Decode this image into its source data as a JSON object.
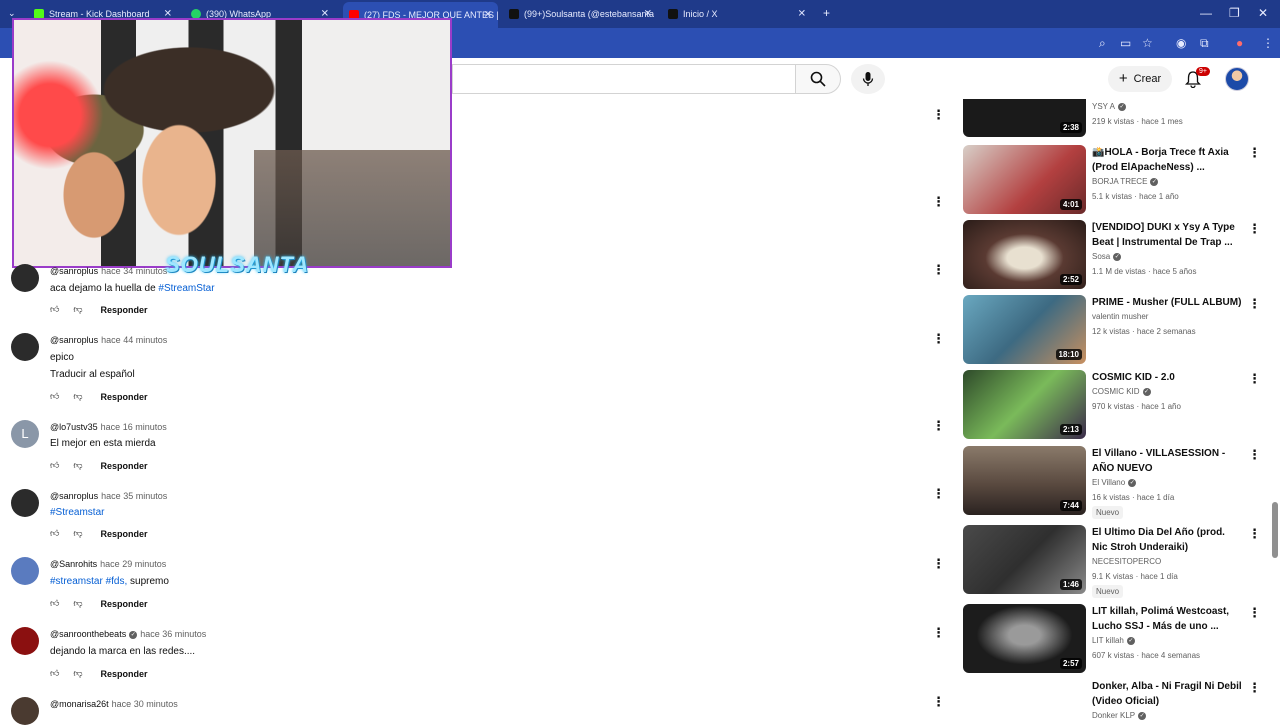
{
  "browser": {
    "tabs": [
      {
        "label": "Stream - Kick Dashboard",
        "color": "#53fc18"
      },
      {
        "label": "(390) WhatsApp",
        "color": "#25d366"
      },
      {
        "label": "(27) FDS - MEJOR QUE ANTES |",
        "color": "#ff0000"
      },
      {
        "label": "(99+)Soulsanta (@estebansanta",
        "color": "#000000"
      },
      {
        "label": "Inicio / X",
        "color": "#000000"
      }
    ],
    "new_tab": "+"
  },
  "header": {
    "create_label": "Crear",
    "notif_badge": "9+"
  },
  "overlay": {
    "logo_text": "SOULSANTA"
  },
  "comments": [
    {
      "handle": "@sanroplus",
      "time": "hace 34 minutos",
      "text": "aca dejamo la huella de ",
      "tags": "#StreamStar",
      "reply": "Responder",
      "avatar": "#2b2b2b"
    },
    {
      "handle": "@sanroplus",
      "time": "hace 44 minutos",
      "text": "epico",
      "extra": "Traducir al español",
      "reply": "Responder",
      "avatar": "#2b2b2b"
    },
    {
      "handle": "@lo7ustv35",
      "time": "hace 16 minutos",
      "text": "El mejor en esta mierda",
      "reply": "Responder",
      "avatar": "#8a97a8",
      "initial": "L"
    },
    {
      "handle": "@sanroplus",
      "time": "hace 35 minutos",
      "text": "",
      "tags": "#Streamstar",
      "reply": "Responder",
      "avatar": "#2b2b2b"
    },
    {
      "handle": "@Sanrohits",
      "time": "hace 29 minutos",
      "text": " supremo",
      "tags": "#streamstar #fds,",
      "reply": "Responder",
      "avatar": "#5a7bbf"
    },
    {
      "handle": "@sanroonthebeats",
      "time": "hace 36 minutos",
      "text": "dejando la marca en las redes....",
      "reply": "Responder",
      "avatar": "#8b1010"
    },
    {
      "handle": "@monarisa26t",
      "time": "hace 30 minutos",
      "text": "",
      "reply": "",
      "avatar": "#4a3a30"
    }
  ],
  "sidebar": [
    {
      "title": "",
      "channel": "YSY A",
      "meta": "219 k vistas · hace 1 mes",
      "duration": "2:38",
      "thumb": "#1a1a1a"
    },
    {
      "title": "📸HOLA - Borja Trece ft Axia (Prod ElApacheNess) ...",
      "channel": "BORJA TRECE",
      "meta": "5.1 k vistas · hace 1 año",
      "duration": "4:01",
      "thumb": "#b34040"
    },
    {
      "title": "[VENDIDO] DUKI x Ysy A Type Beat | Instrumental De Trap ...",
      "channel": "Sosa",
      "meta": "1.1 M de vistas · hace 5 años",
      "duration": "2:52",
      "thumb": "#3a2a28"
    },
    {
      "title": "PRIME - Musher (FULL ALBUM)",
      "channel": "valentin musher",
      "meta": "12 k vistas · hace 2 semanas",
      "duration": "18:10",
      "thumb": "#3d6a82"
    },
    {
      "title": "COSMIC KID - 2.0",
      "channel": "COSMIC KID",
      "meta": "970 k vistas · hace 1 año",
      "duration": "2:13",
      "thumb": "#4a7a3a"
    },
    {
      "title": "El Villano - VILLASESSION - AÑO NUEVO",
      "channel": "El Villano",
      "meta": "16 k vistas · hace 1 día",
      "duration": "7:44",
      "thumb": "#5a4a40",
      "new": "Nuevo"
    },
    {
      "title": "El Ultimo Dia Del Año (prod. Nic Stroh Underaiki)",
      "channel": "NECESITOPERCO",
      "meta": "9.1 K vistas · hace 1 día",
      "duration": "1:46",
      "thumb": "#2f2f2f",
      "new": "Nuevo"
    },
    {
      "title": "LIT killah, Polimá Westcoast, Lucho SSJ - Más de uno ...",
      "channel": "LIT killah",
      "meta": "607 k vistas · hace 4 semanas",
      "duration": "2:57",
      "thumb": "#1c1c1c"
    },
    {
      "title": "Donker, Alba - Ni Fragil Ni Debil (Video Oficial)",
      "channel": "Donker KLP",
      "meta": "",
      "duration": "",
      "thumb": "#ffffff"
    }
  ]
}
